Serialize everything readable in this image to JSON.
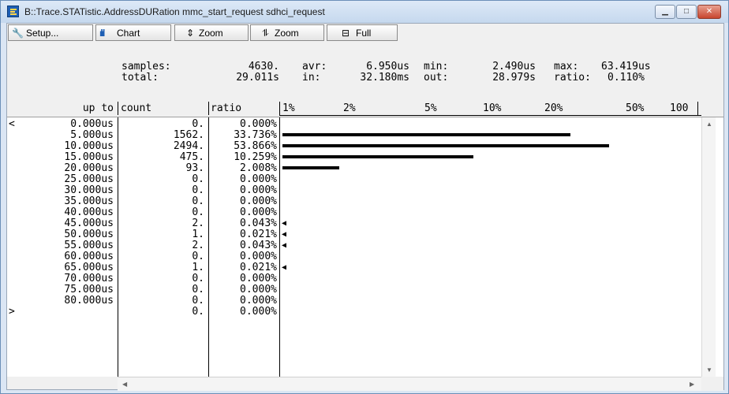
{
  "window": {
    "title": "B::Trace.STATistic.AddressDURation mmc_start_request sdhci_request"
  },
  "toolbar": {
    "setup_label": "Setup...",
    "chart_label": "Chart",
    "zoom_in_label": "Zoom",
    "zoom_out_label": "Zoom",
    "full_label": "Full"
  },
  "stats": {
    "samples_label": "samples:",
    "samples_value": "4630.",
    "avr_label": "avr:",
    "avr_value": "6.950us",
    "min_label": "min:",
    "min_value": "2.490us",
    "max_label": "max:",
    "max_value": "63.419us",
    "total_label": "total:",
    "total_value": "29.011s",
    "in_label": "in:",
    "in_value": "32.180ms",
    "out_label": "out:",
    "out_value": "28.979s",
    "ratio_label": "ratio:",
    "ratio_value": "0.110%"
  },
  "table": {
    "headers": {
      "upto": "up to",
      "count": "count",
      "ratio": "ratio"
    },
    "scale_labels": [
      "1%",
      "2%",
      "5%",
      "10%",
      "20%",
      "50%",
      "100"
    ],
    "rows": [
      {
        "marker": "<",
        "upto": "0.000us",
        "count": "0.",
        "ratio": "0.000%",
        "bar": 0,
        "arrow": false
      },
      {
        "marker": "",
        "upto": "5.000us",
        "count": "1562.",
        "ratio": "33.736%",
        "bar": 0.33736,
        "arrow": false
      },
      {
        "marker": "",
        "upto": "10.000us",
        "count": "2494.",
        "ratio": "53.866%",
        "bar": 0.53866,
        "arrow": false
      },
      {
        "marker": "",
        "upto": "15.000us",
        "count": "475.",
        "ratio": "10.259%",
        "bar": 0.10259,
        "arrow": false
      },
      {
        "marker": "",
        "upto": "20.000us",
        "count": "93.",
        "ratio": "2.008%",
        "bar": 0.02008,
        "arrow": false
      },
      {
        "marker": "",
        "upto": "25.000us",
        "count": "0.",
        "ratio": "0.000%",
        "bar": 0,
        "arrow": false
      },
      {
        "marker": "",
        "upto": "30.000us",
        "count": "0.",
        "ratio": "0.000%",
        "bar": 0,
        "arrow": false
      },
      {
        "marker": "",
        "upto": "35.000us",
        "count": "0.",
        "ratio": "0.000%",
        "bar": 0,
        "arrow": false
      },
      {
        "marker": "",
        "upto": "40.000us",
        "count": "0.",
        "ratio": "0.000%",
        "bar": 0,
        "arrow": false
      },
      {
        "marker": "",
        "upto": "45.000us",
        "count": "2.",
        "ratio": "0.043%",
        "bar": 0,
        "arrow": true
      },
      {
        "marker": "",
        "upto": "50.000us",
        "count": "1.",
        "ratio": "0.021%",
        "bar": 0,
        "arrow": true
      },
      {
        "marker": "",
        "upto": "55.000us",
        "count": "2.",
        "ratio": "0.043%",
        "bar": 0,
        "arrow": true
      },
      {
        "marker": "",
        "upto": "60.000us",
        "count": "0.",
        "ratio": "0.000%",
        "bar": 0,
        "arrow": false
      },
      {
        "marker": "",
        "upto": "65.000us",
        "count": "1.",
        "ratio": "0.021%",
        "bar": 0,
        "arrow": true
      },
      {
        "marker": "",
        "upto": "70.000us",
        "count": "0.",
        "ratio": "0.000%",
        "bar": 0,
        "arrow": false
      },
      {
        "marker": "",
        "upto": "75.000us",
        "count": "0.",
        "ratio": "0.000%",
        "bar": 0,
        "arrow": false
      },
      {
        "marker": "",
        "upto": "80.000us",
        "count": "0.",
        "ratio": "0.000%",
        "bar": 0,
        "arrow": false
      },
      {
        "marker": ">",
        "upto": "",
        "count": "0.",
        "ratio": "0.000%",
        "bar": 0,
        "arrow": false
      }
    ]
  },
  "colors": {
    "accent": "#1e5fb4",
    "close": "#c8452e"
  }
}
